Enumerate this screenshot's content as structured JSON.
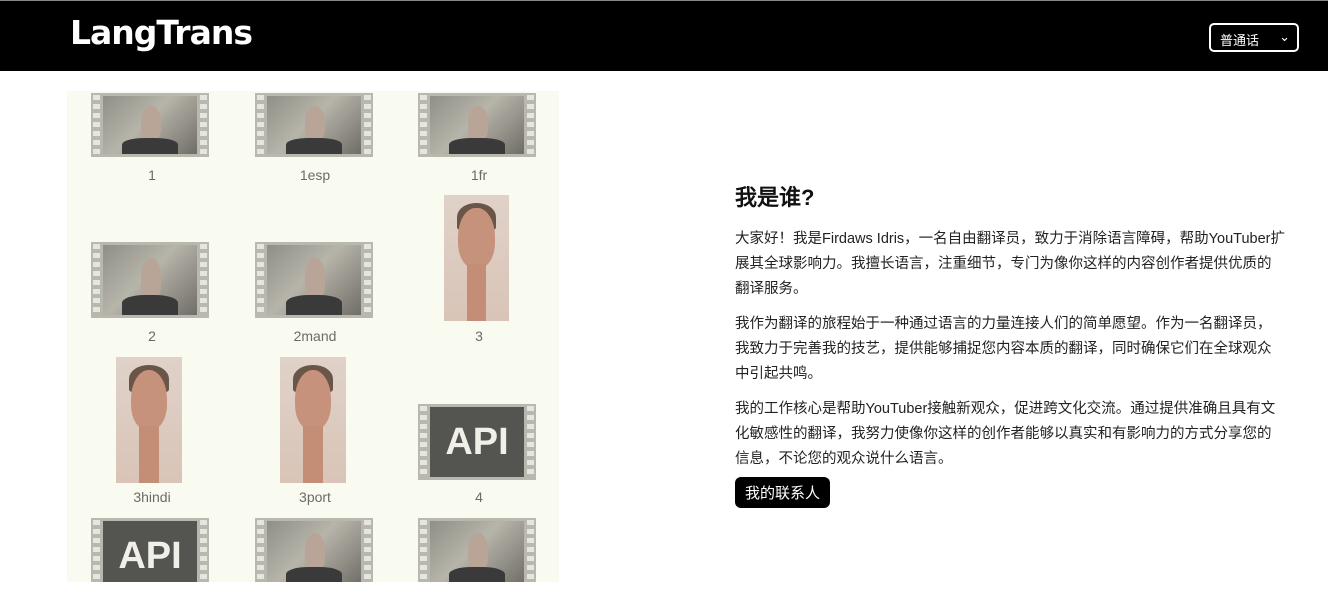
{
  "navbar": {
    "logo": "LangTrans",
    "language_select": {
      "value": "普通话",
      "chevron_icon": "chevron-down-icon"
    }
  },
  "gallery": {
    "items": [
      {
        "label": "1",
        "kind": "video"
      },
      {
        "label": "1esp",
        "kind": "video"
      },
      {
        "label": "1fr",
        "kind": "video"
      },
      {
        "label": "2",
        "kind": "video"
      },
      {
        "label": "2mand",
        "kind": "video"
      },
      {
        "label": "3",
        "kind": "portrait"
      },
      {
        "label": "3hindi",
        "kind": "portrait"
      },
      {
        "label": "3port",
        "kind": "portrait"
      },
      {
        "label": "4",
        "kind": "api",
        "text": "API"
      },
      {
        "label": "",
        "kind": "api",
        "text": "API"
      },
      {
        "label": "",
        "kind": "video"
      },
      {
        "label": "",
        "kind": "video"
      }
    ]
  },
  "about": {
    "title": "我是谁?",
    "paragraphs": [
      "大家好！我是Firdaws Idris，一名自由翻译员，致力于消除语言障碍，帮助YouTuber扩展其全球影响力。我擅长语言，注重细节，专门为像你这样的内容创作者提供优质的翻译服务。",
      "我作为翻译的旅程始于一种通过语言的力量连接人们的简单愿望。作为一名翻译员，我致力于完善我的技艺，提供能够捕捉您内容本质的翻译，同时确保它们在全球观众中引起共鸣。",
      "我的工作核心是帮助YouTuber接触新观众，促进跨文化交流。通过提供准确且具有文化敏感性的翻译，我努力使像你这样的创作者能够以真实和有影响力的方式分享您的信息，不论您的观众说什么语言。"
    ],
    "contact_button": "我的联系人"
  }
}
